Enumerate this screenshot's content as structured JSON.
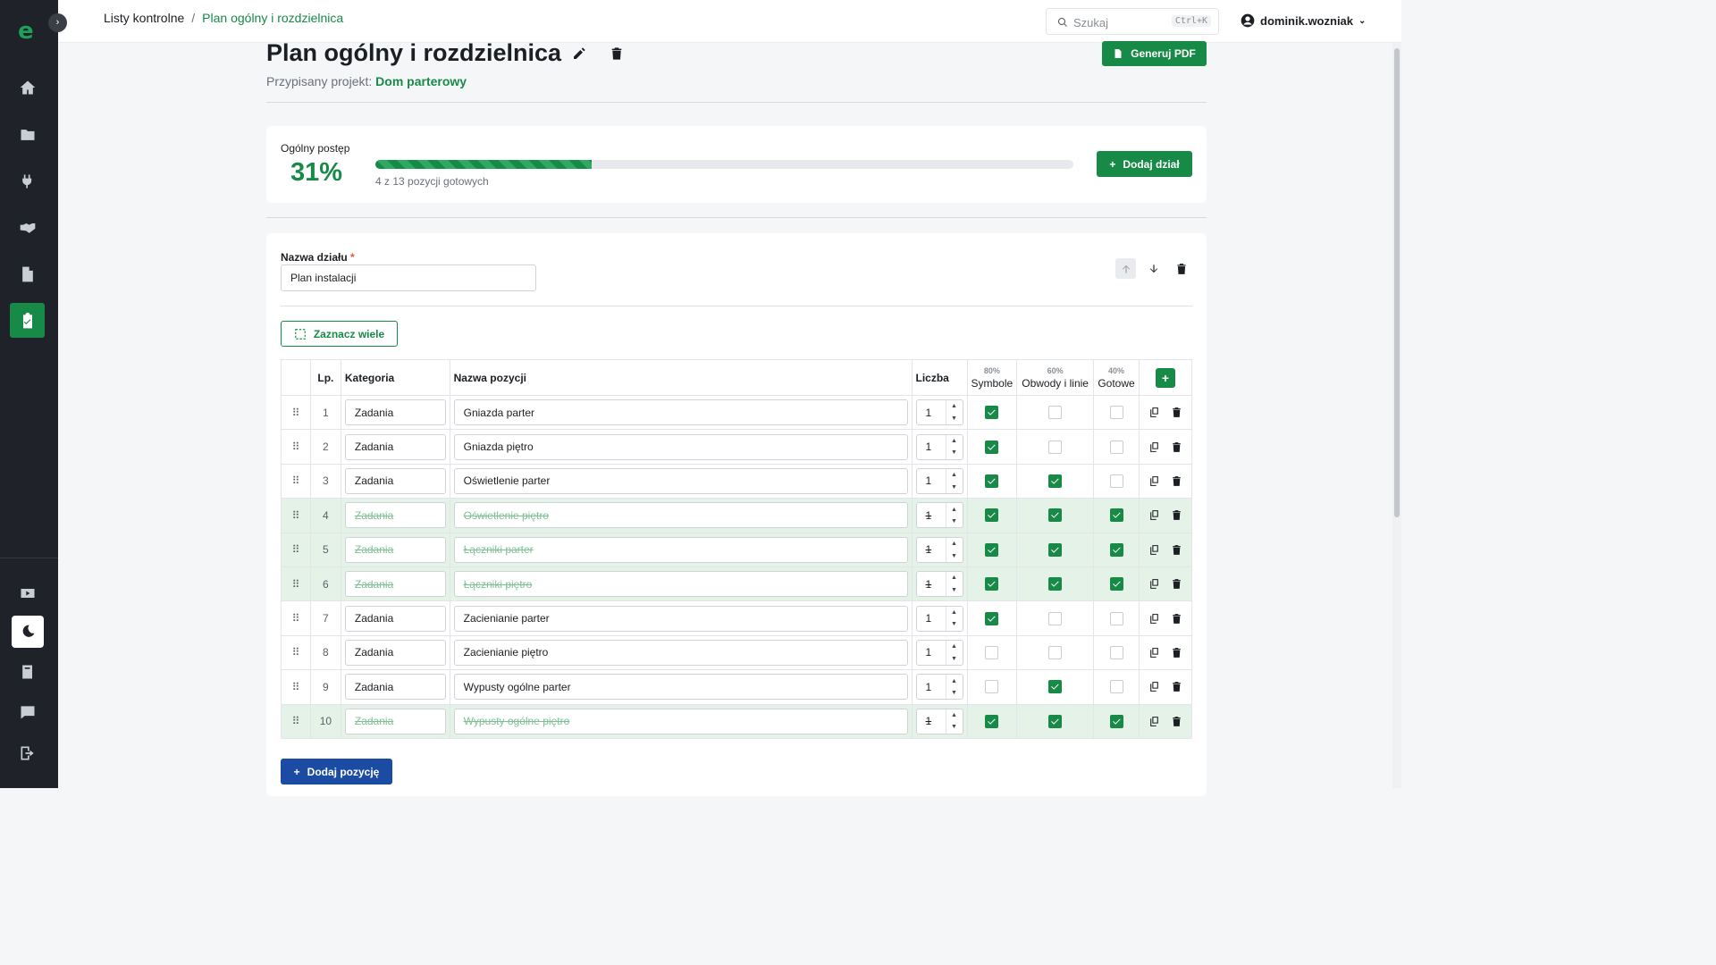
{
  "header": {
    "breadcrumb": [
      "Listy kontrolne",
      "Plan ogólny i rozdzielnica"
    ],
    "search_placeholder": "Szukaj",
    "search_shortcut": "Ctrl+K",
    "username": "dominik.wozniak"
  },
  "sidebar": {
    "logo": "e",
    "items": [
      {
        "icon": "home-icon"
      },
      {
        "icon": "folder-icon"
      },
      {
        "icon": "plug-icon"
      },
      {
        "icon": "handshake-icon"
      },
      {
        "icon": "file-icon"
      },
      {
        "icon": "clipboard-check-icon",
        "active": true
      }
    ],
    "bottom": [
      {
        "icon": "youtube-icon"
      },
      {
        "icon": "moon-icon"
      },
      {
        "icon": "book-icon"
      },
      {
        "icon": "chat-icon"
      },
      {
        "icon": "logout-icon"
      }
    ]
  },
  "page": {
    "title": "Plan ogólny i rozdzielnica",
    "assigned_label": "Przypisany projekt:",
    "assigned_project": "Dom parterowy",
    "pdf_button": "Generuj PDF"
  },
  "progress": {
    "label": "Ogólny postęp",
    "percent_text": "31%",
    "fraction": 0.31,
    "summary": "4 z 13 pozycji gotowych",
    "add_section_button": "Dodaj dział"
  },
  "section": {
    "name_label": "Nazwa działu",
    "required_mark": "*",
    "name_value": "Plan instalacji",
    "select_many_button": "Zaznacz wiele",
    "columns": {
      "lp": "Lp.",
      "category": "Kategoria",
      "name": "Nazwa pozycji",
      "count": "Liczba",
      "symbols_pct": "80%",
      "symbols": "Symbole",
      "circuits_pct": "60%",
      "circuits": "Obwody i linie",
      "done_pct": "40%",
      "done": "Gotowe"
    },
    "rows": [
      {
        "lp": "1",
        "category": "Zadania",
        "name": "Gniazda parter",
        "count": "1",
        "s": true,
        "o": false,
        "g": false
      },
      {
        "lp": "2",
        "category": "Zadania",
        "name": "Gniazda piętro",
        "count": "1",
        "s": true,
        "o": false,
        "g": false
      },
      {
        "lp": "3",
        "category": "Zadania",
        "name": "Oświetlenie parter",
        "count": "1",
        "s": true,
        "o": true,
        "g": false
      },
      {
        "lp": "4",
        "category": "Zadania",
        "name": "Oświetlenie piętro",
        "count": "1",
        "s": true,
        "o": true,
        "g": true
      },
      {
        "lp": "5",
        "category": "Zadania",
        "name": "Łączniki parter",
        "count": "1",
        "s": true,
        "o": true,
        "g": true
      },
      {
        "lp": "6",
        "category": "Zadania",
        "name": "Łączniki piętro",
        "count": "1",
        "s": true,
        "o": true,
        "g": true
      },
      {
        "lp": "7",
        "category": "Zadania",
        "name": "Zacienianie parter",
        "count": "1",
        "s": true,
        "o": false,
        "g": false
      },
      {
        "lp": "8",
        "category": "Zadania",
        "name": "Zacienianie piętro",
        "count": "1",
        "s": false,
        "o": false,
        "g": false
      },
      {
        "lp": "9",
        "category": "Zadania",
        "name": "Wypusty ogólne parter",
        "count": "1",
        "s": false,
        "o": true,
        "g": false
      },
      {
        "lp": "10",
        "category": "Zadania",
        "name": "Wypusty ogólne piętro",
        "count": "1",
        "s": true,
        "o": true,
        "g": true
      }
    ],
    "add_item_button": "Dodaj pozycję"
  },
  "colors": {
    "primary": "#188a47",
    "sidebar": "#1f2329",
    "done_row": "#e4f2e8",
    "blue_button": "#1c4ba3"
  }
}
